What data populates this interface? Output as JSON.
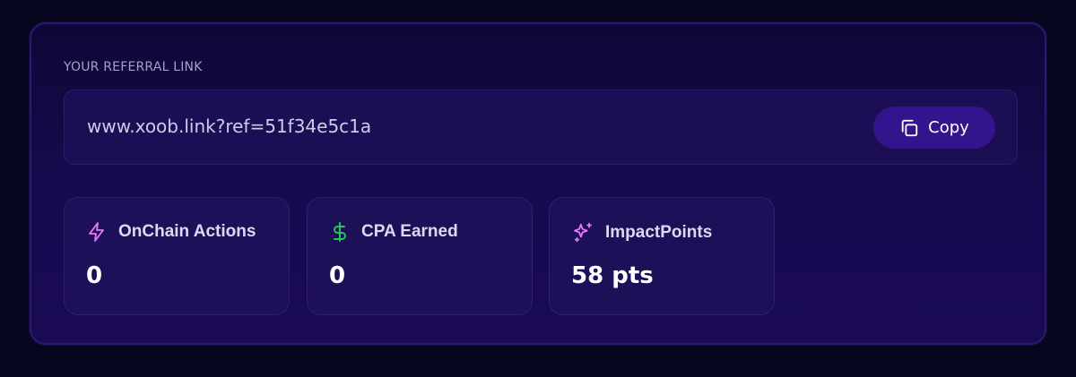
{
  "referral": {
    "label": "YOUR REFERRAL LINK",
    "link": "www.xoob.link?ref=51f34e5c1a",
    "copy_label": "Copy"
  },
  "stats": [
    {
      "title": "OnChain Actions",
      "value": "0",
      "icon": "lightning-icon"
    },
    {
      "title": "CPA Earned",
      "value": "0",
      "icon": "dollar-icon"
    },
    {
      "title": "ImpactPoints",
      "value": "58 pts",
      "icon": "sparkles-icon"
    }
  ],
  "colors": {
    "background": "#06061e",
    "card": "#170a50",
    "button": "#34148c",
    "lightning": "#e879f9",
    "dollar": "#22c55e",
    "sparkles": "#e879f9"
  }
}
